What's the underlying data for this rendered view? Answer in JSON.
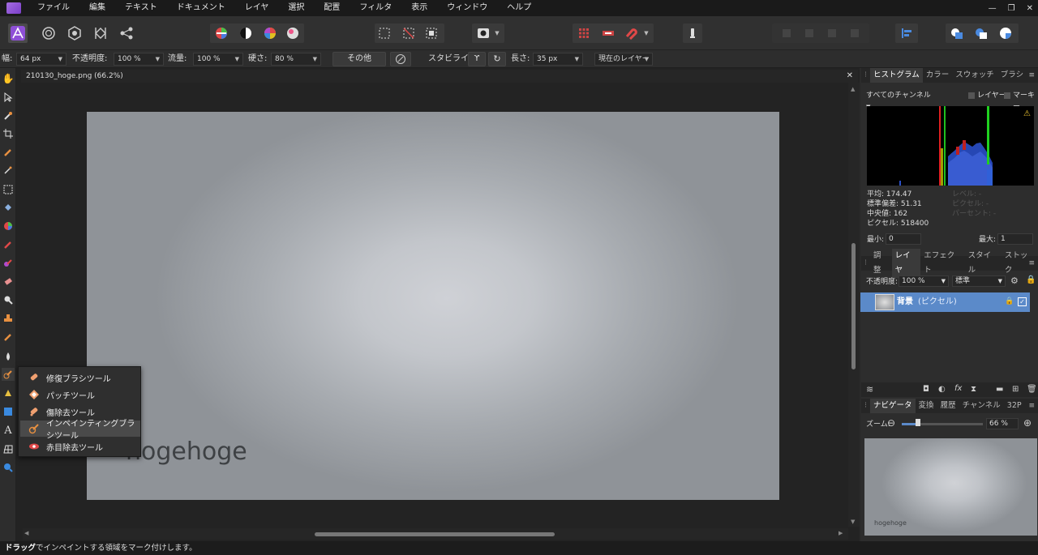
{
  "menubar": {
    "items": [
      "ファイル",
      "編集",
      "テキスト",
      "ドキュメント",
      "レイヤ",
      "選択",
      "配置",
      "フィルタ",
      "表示",
      "ウィンドウ",
      "ヘルプ"
    ]
  },
  "context_bar": {
    "width_label": "幅:",
    "width_value": "64 px",
    "opacity_label": "不透明度:",
    "opacity_value": "100 %",
    "flow_label": "流量:",
    "flow_value": "100 %",
    "hardness_label": "硬さ:",
    "hardness_value": "80 %",
    "other_button": "その他",
    "stabilizer_label": "スタビライザ",
    "length_label": "長さ:",
    "length_value": "35 px",
    "source_value": "現在のレイヤー"
  },
  "document": {
    "tab_title": "210130_hoge.png (66.2%)",
    "canvas_text": "hogehoge"
  },
  "flyout": {
    "items": [
      {
        "label": "修復ブラシツール",
        "selected": false
      },
      {
        "label": "パッチツール",
        "selected": false
      },
      {
        "label": "傷除去ツール",
        "selected": false
      },
      {
        "label": "インペインティングブラシツール",
        "selected": true
      },
      {
        "label": "赤目除去ツール",
        "selected": false
      }
    ]
  },
  "histogram_panel": {
    "tabs": [
      "ヒストグラム",
      "カラー",
      "スウォッチ",
      "ブラシ"
    ],
    "active_tab": 0,
    "channel_select": "すべてのチャンネル",
    "layer_checkbox": "レイヤー",
    "marquee_checkbox": "マーキー",
    "stats": {
      "mean": "平均: 174.47",
      "stddev": "標準偏差: 51.31",
      "median": "中央値: 162",
      "pixels": "ピクセル: 518400"
    },
    "dim_stats": [
      "レベル: -",
      "ピクセル: -",
      "パーセント: -"
    ],
    "min_label": "最小:",
    "min_value": "0",
    "max_label": "最大:",
    "max_value": "1"
  },
  "layers_panel": {
    "tabs": [
      "調整",
      "レイヤ",
      "エフェクト",
      "スタイル",
      "ストック"
    ],
    "active_tab": 1,
    "opacity_label": "不透明度:",
    "opacity_value": "100 %",
    "blend_mode": "標準",
    "layer_name": "背景",
    "layer_type": "(ピクセル)"
  },
  "navigator_panel": {
    "tabs": [
      "ナビゲータ",
      "変換",
      "履歴",
      "チャンネル",
      "32P"
    ],
    "active_tab": 0,
    "zoom_label": "ズーム:",
    "zoom_value": "66 %",
    "zoom_level": 0.2,
    "preview_text": "hogehoge"
  },
  "status": {
    "bold": "ドラッグ",
    "text": "でインペイントする領域をマーク付けします。"
  },
  "colors": {
    "accent": "#5b8ac9",
    "brand": "#8e4fd6"
  }
}
